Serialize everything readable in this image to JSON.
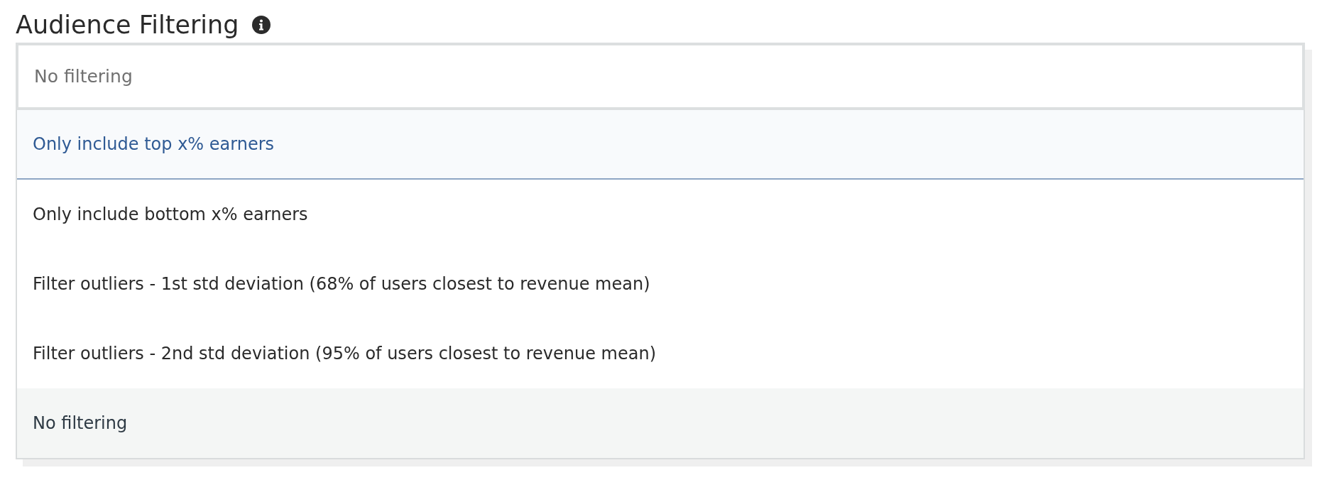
{
  "title": "Audience Filtering",
  "select": {
    "value": "No filtering",
    "expanded": true
  },
  "options": [
    {
      "label": "Only include top x% earners",
      "hovered": true,
      "selected": false
    },
    {
      "label": "Only include bottom x% earners",
      "hovered": false,
      "selected": false
    },
    {
      "label": "Filter outliers - 1st std deviation (68% of users closest to revenue mean)",
      "hovered": false,
      "selected": false
    },
    {
      "label": "Filter outliers - 2nd std deviation (95% of users closest to revenue mean)",
      "hovered": false,
      "selected": false
    },
    {
      "label": "No filtering",
      "hovered": false,
      "selected": true
    }
  ]
}
